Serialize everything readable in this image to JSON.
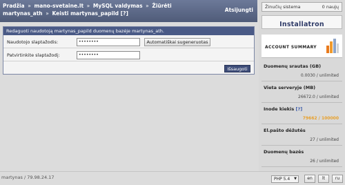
{
  "breadcrumb": {
    "items": [
      "Pradžia",
      "mano-svetaine.lt",
      "MySQL valdymas",
      "Žiūrėti martynas_ath",
      "Keisti martynas_papild"
    ],
    "separator": "»",
    "help": "[?]"
  },
  "logout_label": "Atsijungti",
  "form": {
    "header": "Redaguoti naudotoją martynas_papild duomenų bazėje martynas_ath.",
    "password_label": "Naudotojo slaptažodis:",
    "password_value": "••••••••",
    "generate_label": "Automatiškai sugeneruotas",
    "confirm_label": "Patvirtinkite slaptažodį:",
    "confirm_value": "••••••••",
    "save_label": "Išsaugoti"
  },
  "sidebar": {
    "system_messages_label": "Žinučių sistema",
    "new_count": "0 naujų",
    "logo": "Installatron",
    "account_summary_title": "ACCOUNT SUMMARY",
    "account_summary_icon": "bar-chart-icon",
    "stats": [
      {
        "label": "Duomenų srautas (GB)",
        "value": "0.0030 / unlimited"
      },
      {
        "label": "Vieta serveryje (MB)",
        "value": "26672.0 / unlimited"
      },
      {
        "label": "Inode kiekis",
        "help": "[?]",
        "value": "79662 / 100000",
        "status_color": "#e8a02a"
      },
      {
        "label": "El.pašto dėžutės",
        "value": "27 / unlimited"
      },
      {
        "label": "Duomenų bazės",
        "value": "26 / unlimited"
      }
    ]
  },
  "footer": {
    "user_ip": "martynas / 79.98.24.17",
    "php_version": "PHP 5.4",
    "languages": [
      "en",
      "lt",
      "ru"
    ]
  },
  "colors": {
    "topbar": "#5d6a8a",
    "form_header": "#4a5a86",
    "save_button": "#3d4c78",
    "warning": "#e8a02a"
  }
}
